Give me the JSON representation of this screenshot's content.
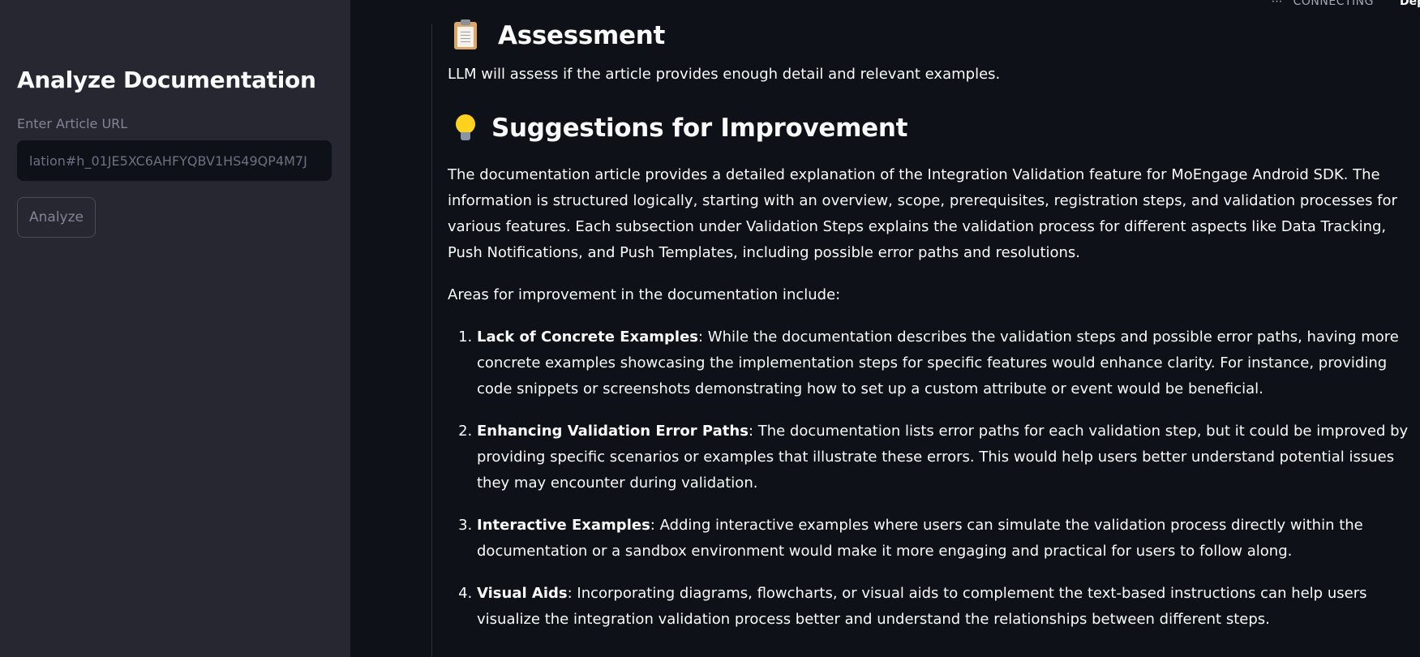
{
  "sidebar": {
    "title": "Analyze Documentation",
    "url_label": "Enter Article URL",
    "url_value": "lation#h_01JE5XC6AHFYQBV1HS49QP4M7J",
    "analyze_label": "Analyze"
  },
  "status": {
    "dots": "⋯",
    "text": "CONNECTING",
    "deploy_label": "Deploy"
  },
  "main": {
    "assessment": {
      "icon": "clipboard-icon",
      "heading": "Assessment",
      "text": "LLM will assess if the article provides enough detail and relevant examples."
    },
    "suggestions": {
      "icon": "light-bulb-icon",
      "heading": "Suggestions for Improvement",
      "intro": "The documentation article provides a detailed explanation of the Integration Validation feature for MoEngage Android SDK. The information is structured logically, starting with an overview, scope, prerequisites, registration steps, and validation processes for various features. Each subsection under Validation Steps explains the validation process for different aspects like Data Tracking, Push Notifications, and Push Templates, including possible error paths and resolutions.",
      "areas_intro": "Areas for improvement in the documentation include:",
      "items": [
        {
          "title": "Lack of Concrete Examples",
          "text": ": While the documentation describes the validation steps and possible error paths, having more concrete examples showcasing the implementation steps for specific features would enhance clarity. For instance, providing code snippets or screenshots demonstrating how to set up a custom attribute or event would be beneficial."
        },
        {
          "title": "Enhancing Validation Error Paths",
          "text": ": The documentation lists error paths for each validation step, but it could be improved by providing specific scenarios or examples that illustrate these errors. This would help users better understand potential issues they may encounter during validation."
        },
        {
          "title": "Interactive Examples",
          "text": ": Adding interactive examples where users can simulate the validation process directly within the documentation or a sandbox environment would make it more engaging and practical for users to follow along."
        },
        {
          "title": "Visual Aids",
          "text": ": Incorporating diagrams, flowcharts, or visual aids to complement the text-based instructions can help users visualize the integration validation process better and understand the relationships between different steps."
        }
      ]
    }
  }
}
